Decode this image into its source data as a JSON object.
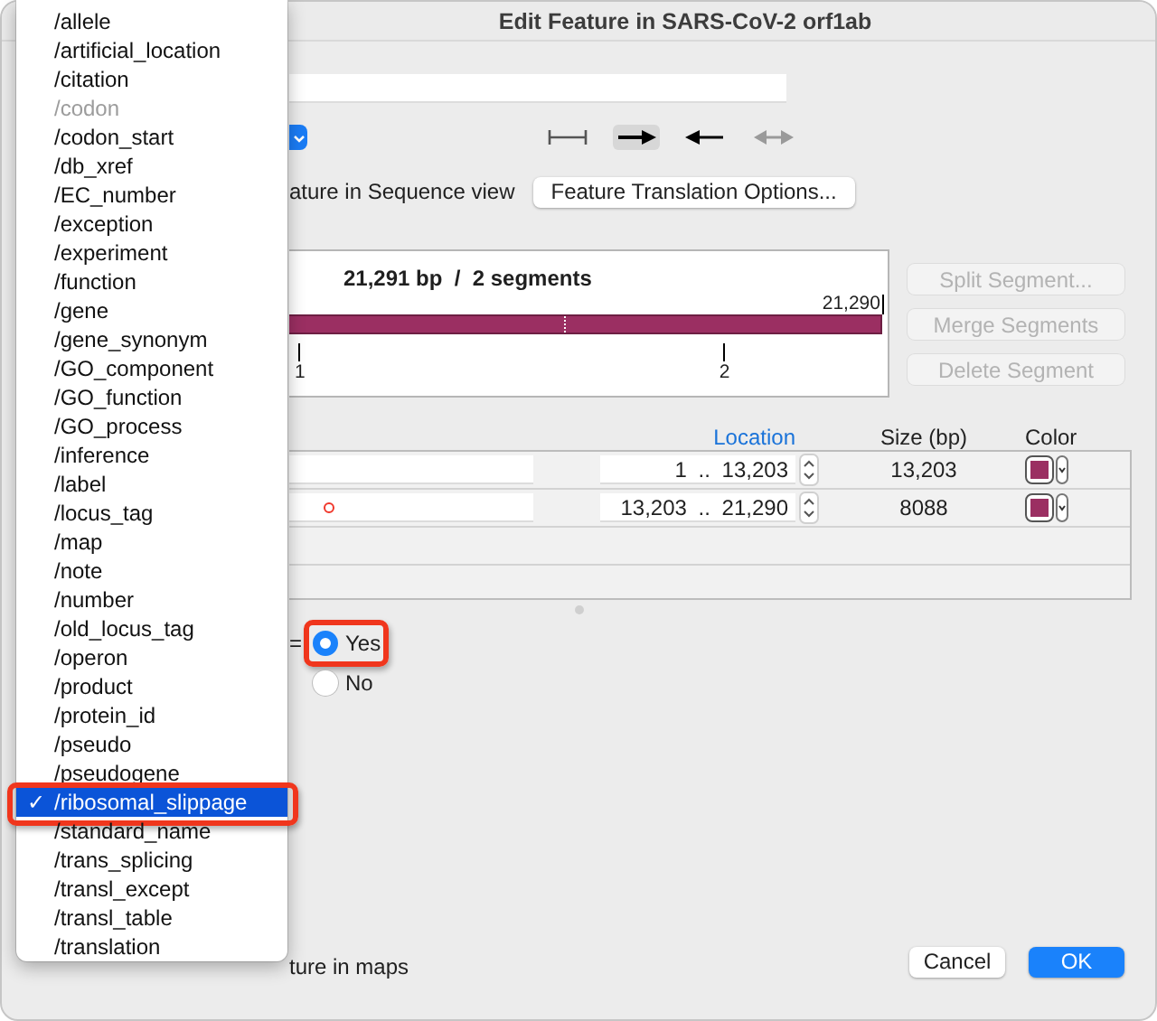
{
  "window": {
    "title": "Edit Feature in SARS-CoV-2 orf1ab"
  },
  "directionality": [
    {
      "kind": "none",
      "selected": false,
      "disabled": false
    },
    {
      "kind": "forward",
      "selected": true,
      "disabled": false
    },
    {
      "kind": "reverse",
      "selected": false,
      "disabled": false
    },
    {
      "kind": "both",
      "selected": false,
      "disabled": true
    }
  ],
  "sequence_view_label": "ature in Sequence view",
  "translation_button": "Feature Translation Options...",
  "segment_map": {
    "summary": "21,291 bp  /  2 segments",
    "end_label": "21,290",
    "color": "#9b2f62",
    "segment_labels": [
      "1",
      "2"
    ]
  },
  "segment_buttons": [
    {
      "label": "Split Segment...",
      "disabled": true
    },
    {
      "label": "Merge Segments",
      "disabled": true
    },
    {
      "label": "Delete Segment",
      "disabled": true
    }
  ],
  "table": {
    "columns": [
      {
        "label": "Location",
        "sorted": true
      },
      {
        "label": "Size (bp)",
        "sorted": false
      },
      {
        "label": "Color",
        "sorted": false
      }
    ],
    "rows": [
      {
        "location": "1 .. 13,203",
        "size": "13,203",
        "color": "#9b2f62",
        "marker": false
      },
      {
        "location": "13,203 .. 21,290",
        "size": "8088",
        "color": "#9b2f62",
        "marker": true
      }
    ]
  },
  "qualifier_value": {
    "equals": "=",
    "options": [
      {
        "label": "Yes",
        "selected": true,
        "highlighted": true
      },
      {
        "label": "No",
        "selected": false,
        "highlighted": false
      }
    ]
  },
  "prioritize_label": "ture in maps",
  "buttons": [
    {
      "label": "Cancel",
      "kind": "secondary"
    },
    {
      "label": "OK",
      "kind": "default"
    }
  ],
  "menu": {
    "check_glyph": "✓",
    "items": [
      {
        "label": "/allele",
        "checked": false,
        "selected": false,
        "disabled": false,
        "highlighted": false
      },
      {
        "label": "/artificial_location",
        "checked": false,
        "selected": false,
        "disabled": false,
        "highlighted": false
      },
      {
        "label": "/citation",
        "checked": false,
        "selected": false,
        "disabled": false,
        "highlighted": false
      },
      {
        "label": "/codon",
        "checked": false,
        "selected": false,
        "disabled": true,
        "highlighted": false
      },
      {
        "label": "/codon_start",
        "checked": false,
        "selected": false,
        "disabled": false,
        "highlighted": false
      },
      {
        "label": "/db_xref",
        "checked": false,
        "selected": false,
        "disabled": false,
        "highlighted": false
      },
      {
        "label": "/EC_number",
        "checked": false,
        "selected": false,
        "disabled": false,
        "highlighted": false
      },
      {
        "label": "/exception",
        "checked": false,
        "selected": false,
        "disabled": false,
        "highlighted": false
      },
      {
        "label": "/experiment",
        "checked": false,
        "selected": false,
        "disabled": false,
        "highlighted": false
      },
      {
        "label": "/function",
        "checked": false,
        "selected": false,
        "disabled": false,
        "highlighted": false
      },
      {
        "label": "/gene",
        "checked": false,
        "selected": false,
        "disabled": false,
        "highlighted": false
      },
      {
        "label": "/gene_synonym",
        "checked": false,
        "selected": false,
        "disabled": false,
        "highlighted": false
      },
      {
        "label": "/GO_component",
        "checked": false,
        "selected": false,
        "disabled": false,
        "highlighted": false
      },
      {
        "label": "/GO_function",
        "checked": false,
        "selected": false,
        "disabled": false,
        "highlighted": false
      },
      {
        "label": "/GO_process",
        "checked": false,
        "selected": false,
        "disabled": false,
        "highlighted": false
      },
      {
        "label": "/inference",
        "checked": false,
        "selected": false,
        "disabled": false,
        "highlighted": false
      },
      {
        "label": "/label",
        "checked": false,
        "selected": false,
        "disabled": false,
        "highlighted": false
      },
      {
        "label": "/locus_tag",
        "checked": false,
        "selected": false,
        "disabled": false,
        "highlighted": false
      },
      {
        "label": "/map",
        "checked": false,
        "selected": false,
        "disabled": false,
        "highlighted": false
      },
      {
        "label": "/note",
        "checked": false,
        "selected": false,
        "disabled": false,
        "highlighted": false
      },
      {
        "label": "/number",
        "checked": false,
        "selected": false,
        "disabled": false,
        "highlighted": false
      },
      {
        "label": "/old_locus_tag",
        "checked": false,
        "selected": false,
        "disabled": false,
        "highlighted": false
      },
      {
        "label": "/operon",
        "checked": false,
        "selected": false,
        "disabled": false,
        "highlighted": false
      },
      {
        "label": "/product",
        "checked": false,
        "selected": false,
        "disabled": false,
        "highlighted": false
      },
      {
        "label": "/protein_id",
        "checked": false,
        "selected": false,
        "disabled": false,
        "highlighted": false
      },
      {
        "label": "/pseudo",
        "checked": false,
        "selected": false,
        "disabled": false,
        "highlighted": false
      },
      {
        "label": "/pseudogene",
        "checked": false,
        "selected": false,
        "disabled": false,
        "highlighted": false
      },
      {
        "label": "/ribosomal_slippage",
        "checked": true,
        "selected": true,
        "disabled": false,
        "highlighted": true
      },
      {
        "label": "/standard_name",
        "checked": false,
        "selected": false,
        "disabled": false,
        "highlighted": false
      },
      {
        "label": "/trans_splicing",
        "checked": false,
        "selected": false,
        "disabled": false,
        "highlighted": false
      },
      {
        "label": "/transl_except",
        "checked": false,
        "selected": false,
        "disabled": false,
        "highlighted": false
      },
      {
        "label": "/transl_table",
        "checked": false,
        "selected": false,
        "disabled": false,
        "highlighted": false
      },
      {
        "label": "/translation",
        "checked": false,
        "selected": false,
        "disabled": false,
        "highlighted": false
      }
    ]
  }
}
